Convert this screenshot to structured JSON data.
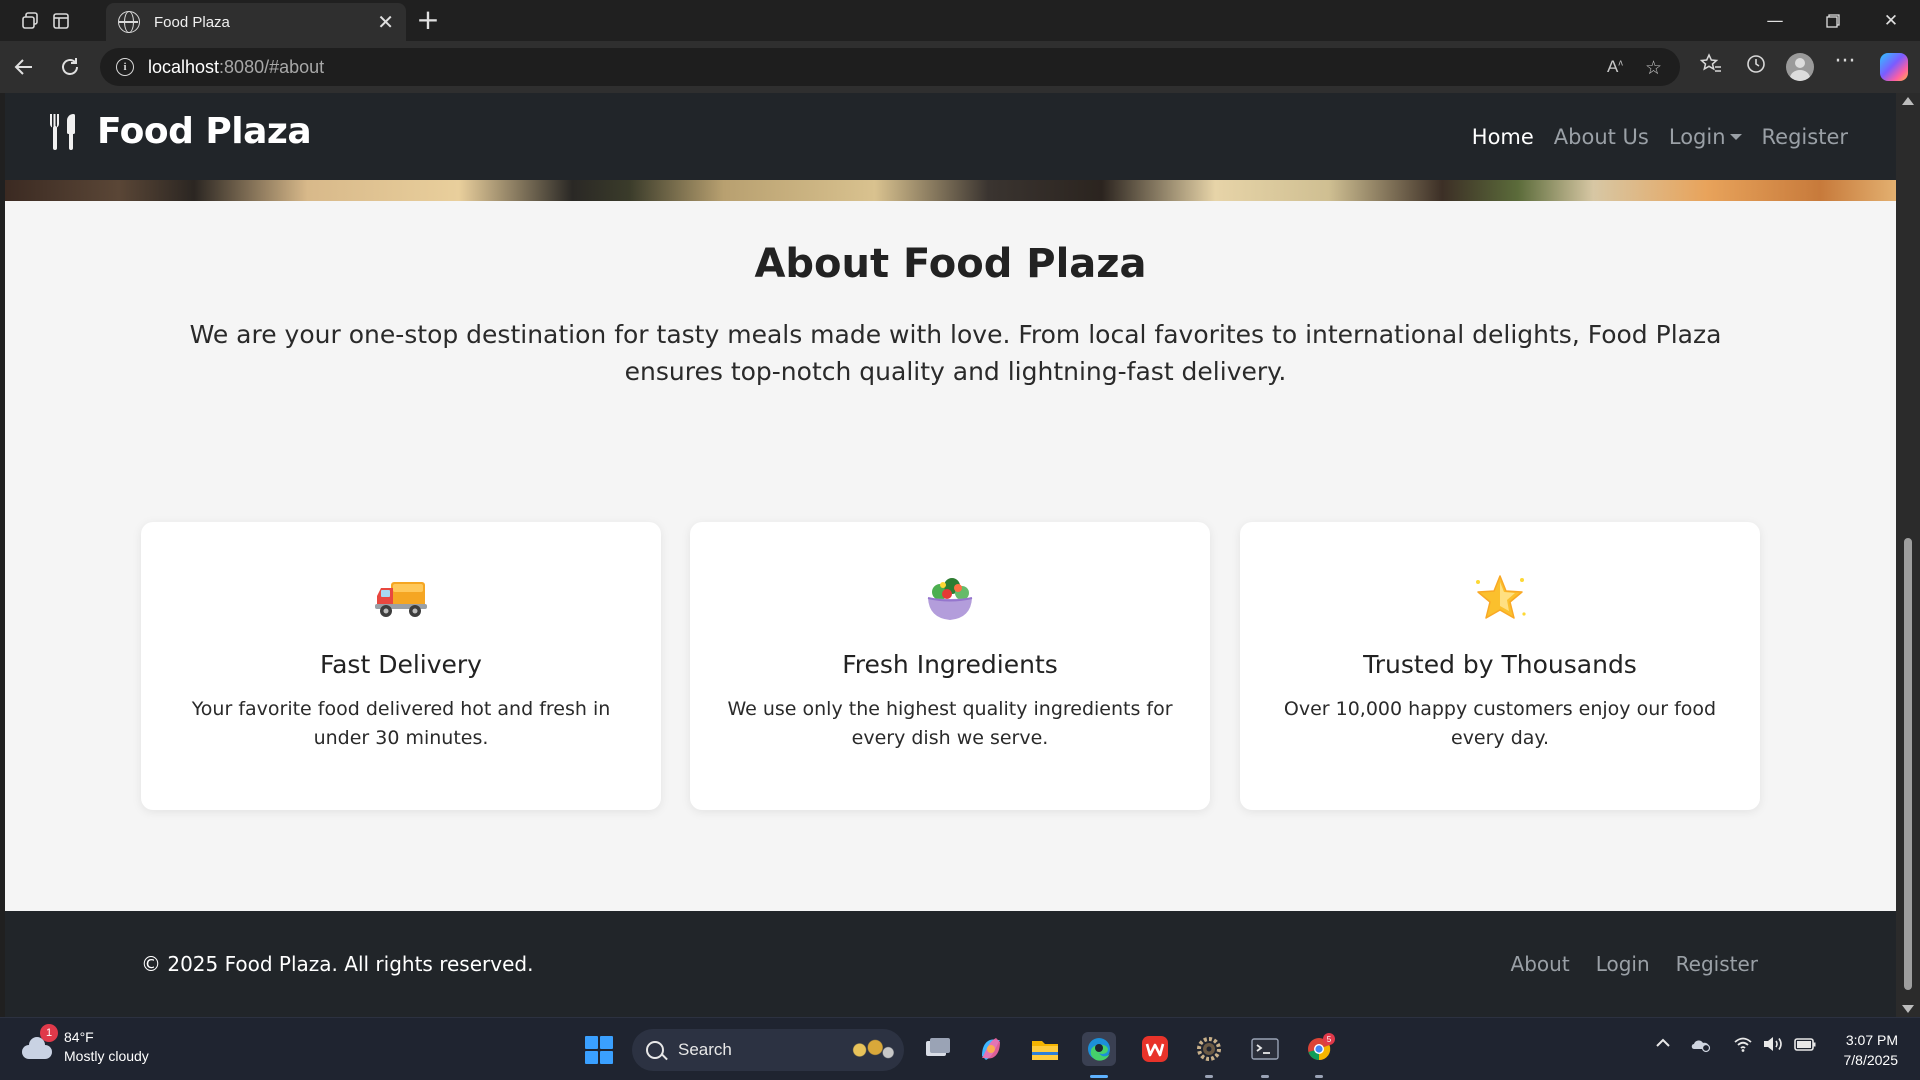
{
  "browser": {
    "tab_title": "Food Plaza",
    "url_host": "localhost",
    "url_path": ":8080/#about"
  },
  "site": {
    "brand": "Food Plaza",
    "nav": {
      "home": "Home",
      "about": "About Us",
      "login": "Login",
      "register": "Register"
    }
  },
  "about": {
    "title": "About Food Plaza",
    "description": "We are your one-stop destination for tasty meals made with love. From local favorites to international delights, Food Plaza ensures top-notch quality and lightning-fast delivery.",
    "cards": [
      {
        "icon": "delivery-truck-icon",
        "title": "Fast Delivery",
        "text": "Your favorite food delivered hot and fresh in under 30 minutes."
      },
      {
        "icon": "salad-bowl-icon",
        "title": "Fresh Ingredients",
        "text": "We use only the highest quality ingredients for every dish we serve."
      },
      {
        "icon": "star-icon",
        "title": "Trusted by Thousands",
        "text": "Over 10,000 happy customers enjoy our food every day."
      }
    ]
  },
  "footer": {
    "copyright": "© 2025 Food Plaza. All rights reserved.",
    "links": {
      "about": "About",
      "login": "Login",
      "register": "Register"
    }
  },
  "taskbar": {
    "weather_badge": "1",
    "temperature": "84°F",
    "condition": "Mostly cloudy",
    "search_label": "Search",
    "chrome_badge": "5",
    "time": "3:07 PM",
    "date": "7/8/2025"
  },
  "colors": {
    "navbar_bg": "#212529",
    "page_bg": "#f5f5f5",
    "nav_link": "#9aa0a6",
    "nav_link_active": "#ffffff"
  }
}
